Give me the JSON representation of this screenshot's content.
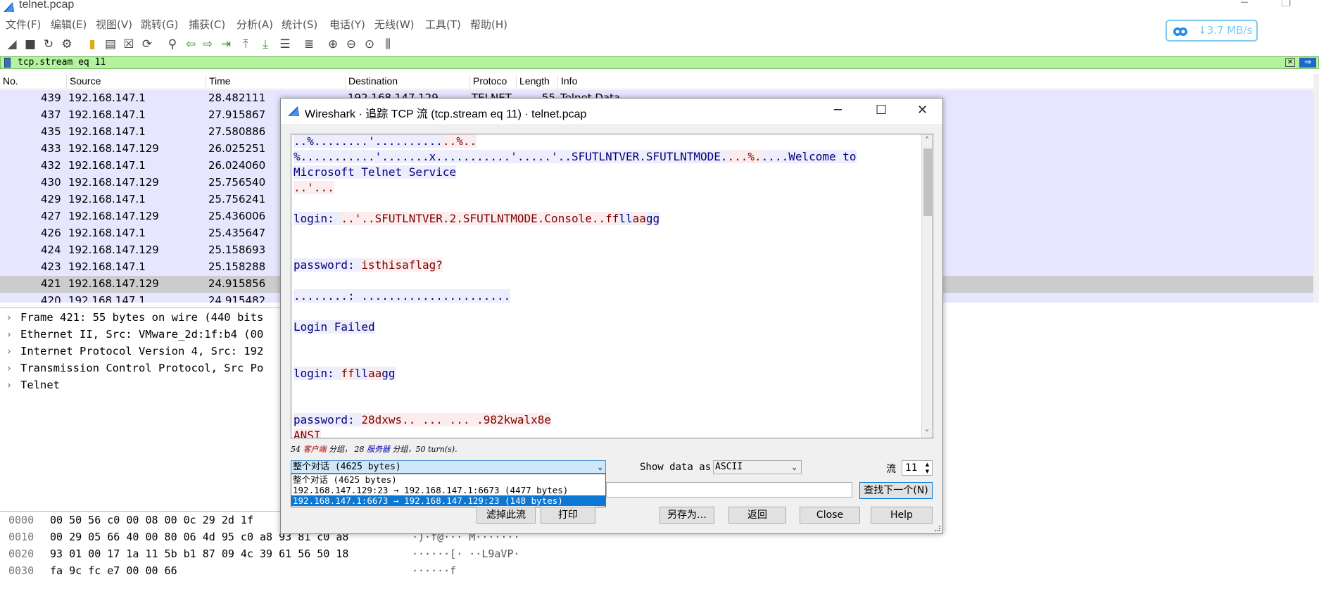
{
  "window": {
    "title": "telnet.pcap",
    "minimize": "─",
    "restore": "❐"
  },
  "menu": [
    "文件(F)",
    "编辑(E)",
    "视图(V)",
    "跳转(G)",
    "捕获(C)",
    "分析(A)",
    "统计(S)",
    "电话(Y)",
    "无线(W)",
    "工具(T)",
    "帮助(H)"
  ],
  "net_speed": {
    "value": "3.7 MB/s",
    "arrow": "↓",
    "color": "#7ec8f0"
  },
  "toolbar_icons": [
    "shark-fin-icon",
    "stop-icon",
    "restart-icon",
    "options-gear-icon",
    "open-file-icon",
    "save-file-icon",
    "close-file-icon",
    "reload-icon",
    "find-icon",
    "back-icon",
    "forward-icon",
    "goto-packet-icon",
    "first-packet-icon",
    "last-packet-icon",
    "autoscroll-icon",
    "colorize-icon",
    "zoom-in-icon",
    "zoom-out-icon",
    "normal-size-icon",
    "resize-columns-icon"
  ],
  "filter": {
    "value": "tcp.stream eq 11",
    "bg_color": "#b4f29e"
  },
  "packet_list": {
    "columns": [
      "No.",
      "Source",
      "Time",
      "Destination",
      "Protoco",
      "Length",
      "Info"
    ],
    "first_row_extra": {
      "destination": "192.168.147.129",
      "protocol": "TELNET",
      "length": "55",
      "info": "Telnet Data"
    },
    "rows": [
      {
        "no": "439",
        "source": "192.168.147.1",
        "time": "28.482111"
      },
      {
        "no": "437",
        "source": "192.168.147.1",
        "time": "27.915867"
      },
      {
        "no": "435",
        "source": "192.168.147.1",
        "time": "27.580886"
      },
      {
        "no": "433",
        "source": "192.168.147.129",
        "time": "26.025251"
      },
      {
        "no": "432",
        "source": "192.168.147.1",
        "time": "26.024060"
      },
      {
        "no": "430",
        "source": "192.168.147.129",
        "time": "25.756540"
      },
      {
        "no": "429",
        "source": "192.168.147.1",
        "time": "25.756241"
      },
      {
        "no": "427",
        "source": "192.168.147.129",
        "time": "25.436006"
      },
      {
        "no": "426",
        "source": "192.168.147.1",
        "time": "25.435647"
      },
      {
        "no": "424",
        "source": "192.168.147.129",
        "time": "25.158693"
      },
      {
        "no": "423",
        "source": "192.168.147.1",
        "time": "25.158288"
      },
      {
        "no": "421",
        "source": "192.168.147.129",
        "time": "24.915856"
      },
      {
        "no": "420",
        "source": "192.168.147.1",
        "time": "24.915482"
      }
    ],
    "selected_no": "421",
    "row_color": "#e7e6ff",
    "selected_color": "#cccccc"
  },
  "details": [
    "Frame 421: 55 bytes on wire (440 bits",
    "Ethernet II, Src: VMware_2d:1f:b4 (00",
    "Internet Protocol Version 4, Src: 192",
    "Transmission Control Protocol, Src Po",
    "Telnet"
  ],
  "hex": [
    {
      "offset": "0000",
      "bytes": "00 50 56 c0 00 08 00 0c  29 2d 1f",
      "ascii": ""
    },
    {
      "offset": "0010",
      "bytes": "00 29 05 66 40 00 80 06  4d 95 c0 a8 93 81 c0 a8",
      "ascii": "·)·f@··· M·······"
    },
    {
      "offset": "0020",
      "bytes": "93 01 00 17 1a 11 5b b1  87 09 4c 39 61 56 50 18",
      "ascii": "······[· ··L9aVP·"
    },
    {
      "offset": "0030",
      "bytes": "fa 9c fc e7 00 00 66",
      "ascii": "······f"
    }
  ],
  "dialog": {
    "title": "Wireshark · 追踪 TCP 流 (tcp.stream eq 11) · telnet.pcap",
    "controls": {
      "minimize": "─",
      "maximize": "☐",
      "close": "✕"
    },
    "stream_lines": [
      {
        "segments": [
          {
            "text": "..%........'..........",
            "who": "server"
          },
          {
            "text": "..%..",
            "who": "client"
          }
        ]
      },
      {
        "segments": [
          {
            "text": "%...........'.......x...........'.....'..SFUTLNTVER.SFUTLNTMODE.",
            "who": "server"
          },
          {
            "text": "...%.",
            "who": "client"
          },
          {
            "text": "....Welcome to ",
            "who": "server"
          }
        ]
      },
      {
        "segments": [
          {
            "text": "Microsoft Telnet Service ",
            "who": "server"
          }
        ]
      },
      {
        "segments": [
          {
            "text": "..'...",
            "who": "client"
          }
        ]
      },
      {
        "segments": []
      },
      {
        "segments": [
          {
            "text": "login: ",
            "who": "server"
          },
          {
            "text": "..'..SFUTLNTVER.2.SFUTLNTMODE.Console..ff",
            "who": "client"
          },
          {
            "text": "ll",
            "who": "server"
          },
          {
            "text": "aa",
            "who": "client"
          },
          {
            "text": "gg",
            "who": "server"
          }
        ]
      },
      {
        "segments": []
      },
      {
        "segments": []
      },
      {
        "segments": [
          {
            "text": "password: ",
            "who": "server"
          },
          {
            "text": "isthisaflag?",
            "who": "client"
          }
        ]
      },
      {
        "segments": []
      },
      {
        "segments": [
          {
            "text": "........: ......................",
            "who": "server"
          }
        ]
      },
      {
        "segments": []
      },
      {
        "segments": [
          {
            "text": "Login Failed",
            "who": "server"
          }
        ]
      },
      {
        "segments": []
      },
      {
        "segments": []
      },
      {
        "segments": [
          {
            "text": "login: ",
            "who": "server"
          },
          {
            "text": "ff",
            "who": "client"
          },
          {
            "text": "ll",
            "who": "server"
          },
          {
            "text": "aa",
            "who": "client"
          },
          {
            "text": "gg",
            "who": "server"
          }
        ]
      },
      {
        "segments": []
      },
      {
        "segments": []
      },
      {
        "segments": [
          {
            "text": "password: ",
            "who": "server"
          },
          {
            "text": "28dxws.. ... ... .982kwalx8e",
            "who": "client"
          }
        ]
      },
      {
        "segments": [
          {
            "text": "           ANSI",
            "who": "client"
          }
        ]
      }
    ],
    "stats": {
      "count1": "54",
      "client_label": "客户端",
      "mid1": "分组，",
      "count2": "28",
      "server_label": "服务器",
      "mid2": "分组，50 turn(s)."
    },
    "conversation": {
      "selected": "整个对话 (4625 bytes)",
      "options": [
        "整个对话 (4625 bytes)",
        "192.168.147.129:23 → 192.168.147.1:6673 (4477 bytes)",
        "192.168.147.1:6673 → 192.168.147.129:23 (148 bytes)"
      ],
      "highlighted": 2
    },
    "show_data_as": {
      "label": "Show data as",
      "value": "ASCII"
    },
    "stream": {
      "label": "流",
      "value": "11"
    },
    "find_next": "查找下一个(N)",
    "buttons": [
      "滤掉此流",
      "打印",
      "另存为…",
      "返回",
      "Close",
      "Help"
    ],
    "client_color": "#7e0000",
    "client_bg": "#fbeded",
    "server_color": "#00007f",
    "server_bg": "#ededfb"
  }
}
